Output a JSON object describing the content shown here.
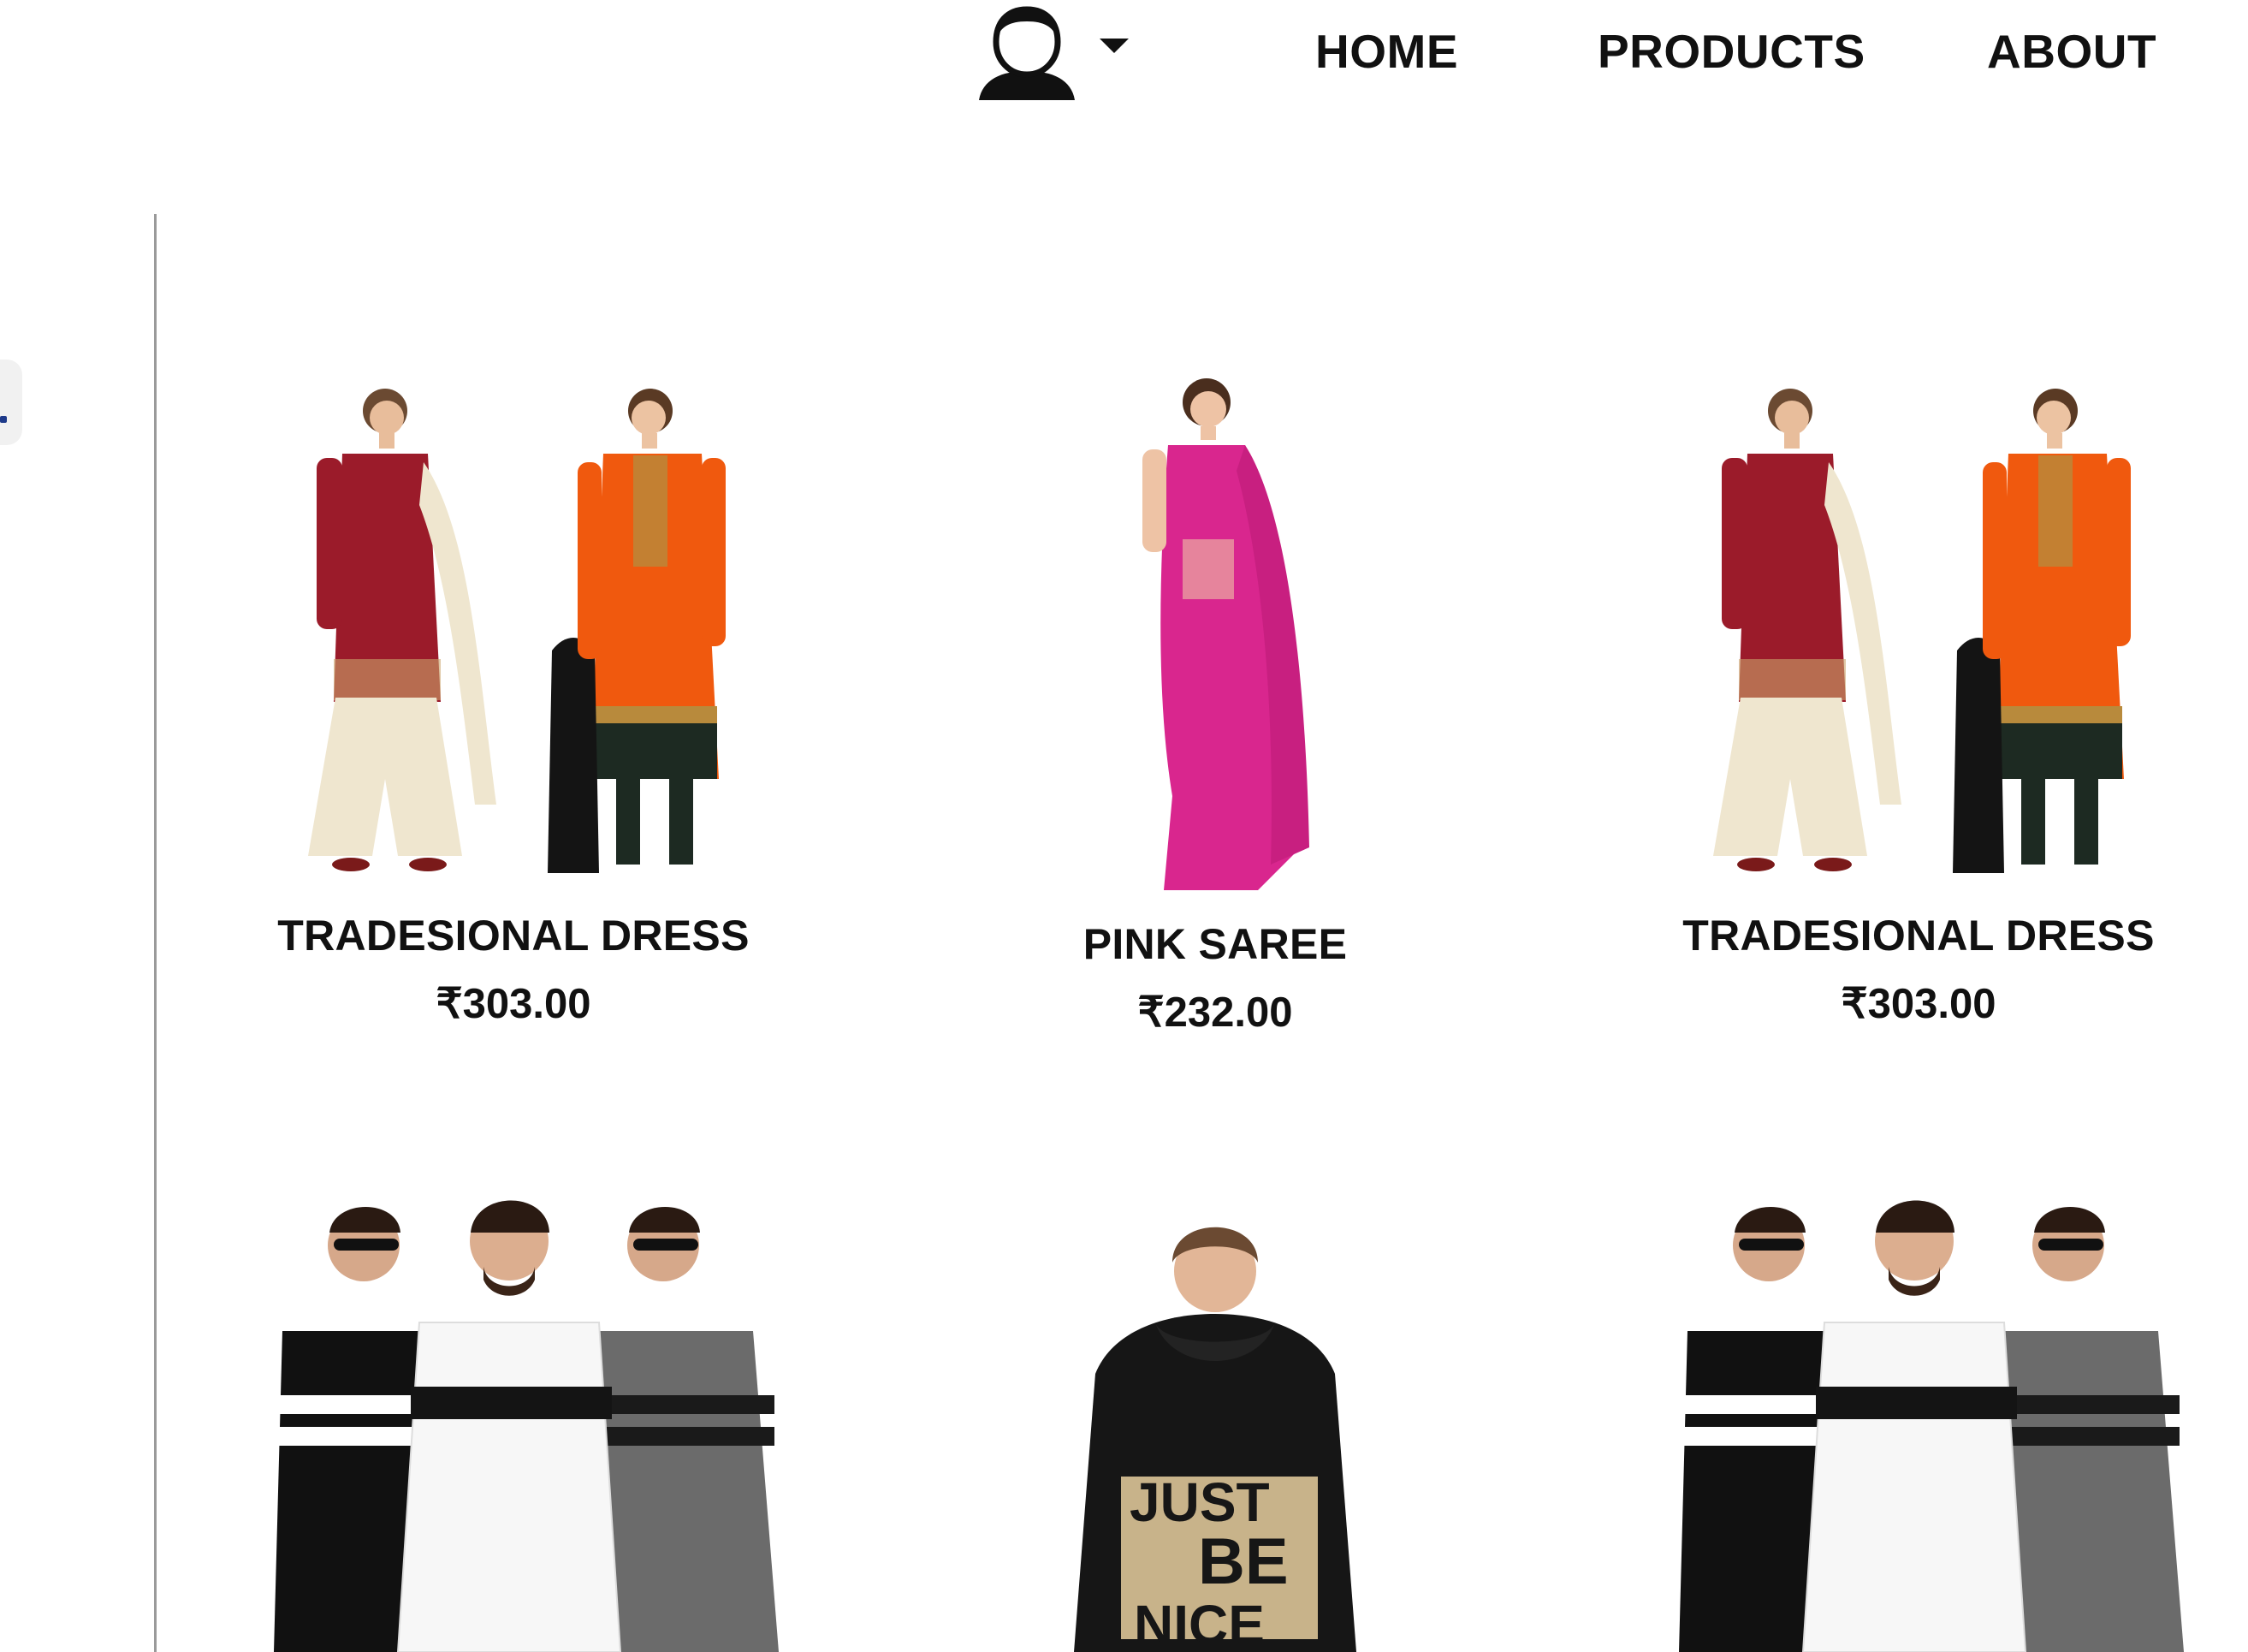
{
  "nav": {
    "user_icon": "user-avatar-icon",
    "caret_icon": "caret-down-icon",
    "links": [
      "HOME",
      "PRODUCTS",
      "ABOUT"
    ]
  },
  "products": [
    {
      "name": "TRADESIONAL DRESS",
      "price": "₹303.00",
      "image": "two-women-salwar-suits"
    },
    {
      "name": "PINK SAREE",
      "price": "₹232.00",
      "image": "woman-pink-saree"
    },
    {
      "name": "TRADESIONAL DRESS",
      "price": "₹303.00",
      "image": "two-women-salwar-suits"
    },
    {
      "image": "three-men-striped-tshirts"
    },
    {
      "image": "man-black-hoodie-just-be-nice"
    },
    {
      "image": "three-men-striped-tshirts"
    }
  ],
  "hoodie_print": [
    "JUST",
    "BE",
    "NICE"
  ],
  "colors": {
    "maroon": "#9b1b2a",
    "orange": "#f0590e",
    "pink": "#d9268e",
    "cream": "#efe6cf",
    "black": "#141414",
    "gray": "#6b6b6b"
  }
}
